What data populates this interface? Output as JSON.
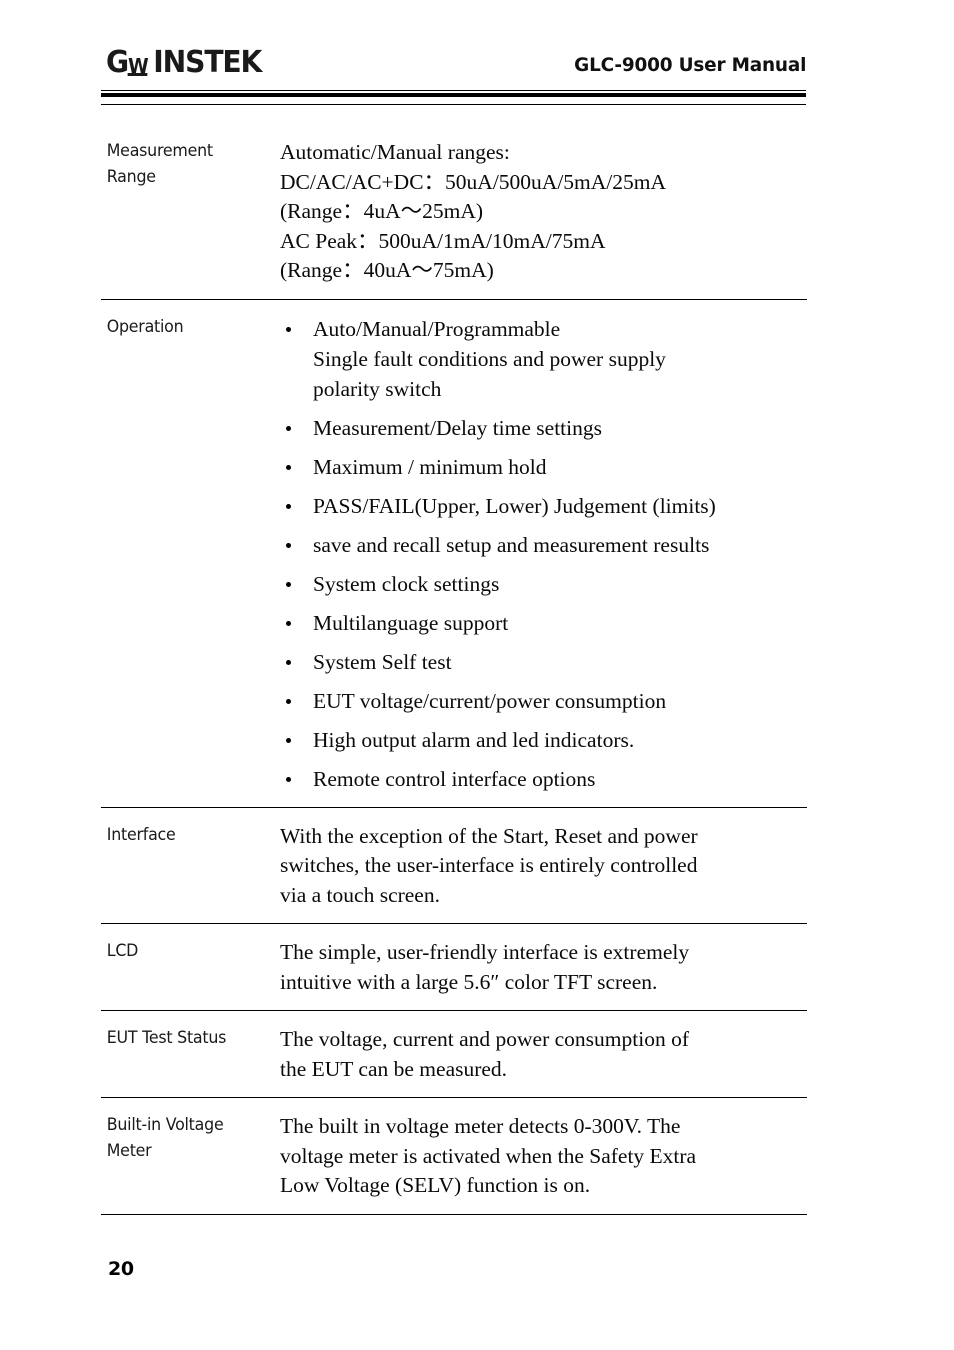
{
  "header": {
    "logo_g": "G",
    "logo_w": "W",
    "logo_instek": "INSTEK",
    "title": "GLC-9000 User Manual"
  },
  "footer": {
    "page_number": "20"
  },
  "spec_table": {
    "rows": [
      {
        "label": "Measurement Range",
        "label_lines": [
          "Measurement",
          "Range"
        ],
        "type": "lines",
        "lines": [
          "Automatic/Manual ranges:",
          "DC/AC/AC+DC：50uA/500uA/5mA/25mA",
          "(Range：4uA～25mA)",
          "AC Peak：500uA/1mA/10mA/75mA",
          "(Range：40uA～75mA)"
        ]
      },
      {
        "label": "Operation",
        "label_lines": [
          "Operation"
        ],
        "type": "bullets",
        "bullets": [
          {
            "text": "Auto/Manual/Programmable",
            "continuation": [
              "Single fault conditions and power supply",
              "polarity switch"
            ]
          },
          {
            "text": "Measurement/Delay time settings",
            "continuation": []
          },
          {
            "text": "Maximum / minimum hold",
            "continuation": []
          },
          {
            "text": "PASS/FAIL(Upper, Lower) Judgement (limits)",
            "continuation": []
          },
          {
            "text": "save and recall setup and measurement results",
            "continuation": []
          },
          {
            "text": "System clock settings",
            "continuation": []
          },
          {
            "text": "Multilanguage support",
            "continuation": []
          },
          {
            "text": "System Self test",
            "continuation": []
          },
          {
            "text": "EUT voltage/current/power consumption",
            "continuation": []
          },
          {
            "text": "High output alarm and led indicators.",
            "continuation": []
          },
          {
            "text": "Remote control interface options",
            "continuation": []
          }
        ]
      },
      {
        "label": "Interface",
        "label_lines": [
          "Interface"
        ],
        "type": "lines",
        "lines": [
          "With the exception of the Start, Reset and power",
          "switches, the user-interface is entirely controlled",
          "via a touch screen."
        ]
      },
      {
        "label": "LCD",
        "label_lines": [
          "LCD"
        ],
        "type": "lines",
        "lines": [
          "The simple, user-friendly interface is extremely",
          "intuitive with a large 5.6″ color TFT screen."
        ]
      },
      {
        "label": "EUT Test Status",
        "label_lines": [
          "EUT Test Status"
        ],
        "type": "lines",
        "lines": [
          "The voltage, current and power consumption of",
          "the EUT can be measured."
        ]
      },
      {
        "label": "Built-in Voltage Meter",
        "label_lines": [
          "Built-in Voltage",
          "Meter"
        ],
        "type": "lines",
        "lines": [
          "The built in voltage meter detects 0-300V. The",
          "voltage meter is activated when the Safety Extra",
          "Low Voltage (SELV) function is on."
        ]
      }
    ]
  }
}
